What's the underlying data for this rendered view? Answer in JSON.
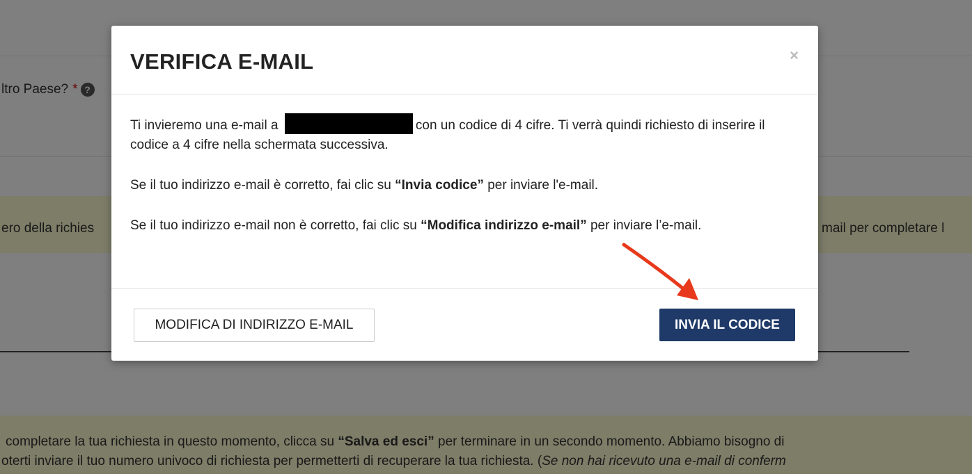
{
  "background": {
    "question_label": "ltro Paese?",
    "required_marker": "*",
    "help_icon_glyph": "?",
    "band_text_left": "ero della richies",
    "band_text_right": "mail per completare l",
    "paragraph_line1_pre": "completare la tua richiesta in questo momento, clicca su ",
    "paragraph_line1_bold": "“Salva ed esci”",
    "paragraph_line1_post": " per terminare in un secondo momento. Abbiamo bisogno di",
    "paragraph_line2_pre": "oterti inviare il tuo numero univoco di richiesta per permetterti di recuperare la tua richiesta. (",
    "paragraph_line2_italic": "Se non hai ricevuto una e-mail di conferm"
  },
  "modal": {
    "title": "VERIFICA E-MAIL",
    "close_glyph": "×",
    "body": {
      "p1_pre": "Ti invieremo una e-mail a ",
      "p1_post": "con un codice di 4 cifre. Ti verrà quindi richiesto di inserire il codice a 4 cifre nella schermata successiva.",
      "p2_pre": "Se il tuo indirizzo e-mail è corretto, fai clic su ",
      "p2_bold": "“Invia codice”",
      "p2_post": " per inviare l'e-mail.",
      "p3_pre": "Se il tuo indirizzo e-mail non è corretto, fai clic su ",
      "p3_bold": "“Modifica indirizzo e-mail”",
      "p3_post": " per inviare l’e-mail."
    },
    "footer": {
      "secondary_label": "MODIFICA DI INDIRIZZO E-MAIL",
      "primary_label": "INVIA IL CODICE"
    }
  },
  "colors": {
    "primary_button": "#1f3a68",
    "annotation_arrow": "#e8391c",
    "highlight_band": "#fbfbd0"
  }
}
